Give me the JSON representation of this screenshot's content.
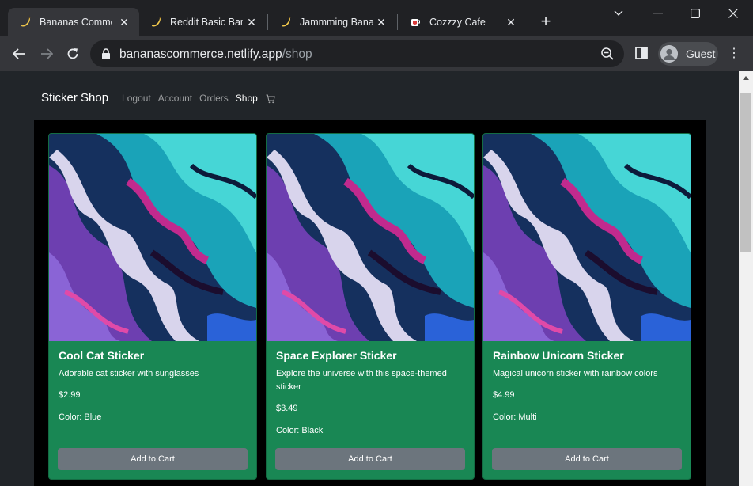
{
  "browser": {
    "tabs": [
      {
        "title": "Bananas Commerce",
        "icon": "banana-icon",
        "active": true
      },
      {
        "title": "Reddit Basic Bananas",
        "icon": "banana-icon",
        "active": false
      },
      {
        "title": "Jammming Bananas",
        "icon": "banana-icon",
        "active": false
      },
      {
        "title": "Cozzzy Cafe",
        "icon": "coffee-cup-icon",
        "active": false
      }
    ],
    "url_host": "bananascommerce.netlify.app",
    "url_path": "/shop",
    "profile_label": "Guest"
  },
  "site": {
    "brand": "Sticker Shop",
    "nav": [
      "Logout",
      "Account",
      "Orders",
      "Shop"
    ],
    "active_nav": "Shop"
  },
  "products": [
    {
      "name": "Cool Cat Sticker",
      "description": "Adorable cat sticker with sunglasses",
      "price": "$2.99",
      "color": "Color: Blue",
      "button": "Add to Cart"
    },
    {
      "name": "Space Explorer Sticker",
      "description": "Explore the universe with this space-themed sticker",
      "price": "$3.49",
      "color": "Color: Black",
      "button": "Add to Cart"
    },
    {
      "name": "Rainbow Unicorn Sticker",
      "description": "Magical unicorn sticker with rainbow colors",
      "price": "$4.99",
      "color": "Color: Multi",
      "button": "Add to Cart"
    }
  ],
  "colors": {
    "card_bg": "#198754",
    "button_bg": "#6c757d",
    "navbar_bg": "#212529",
    "chrome_tabstrip": "#202124",
    "chrome_toolbar": "#35363a"
  }
}
